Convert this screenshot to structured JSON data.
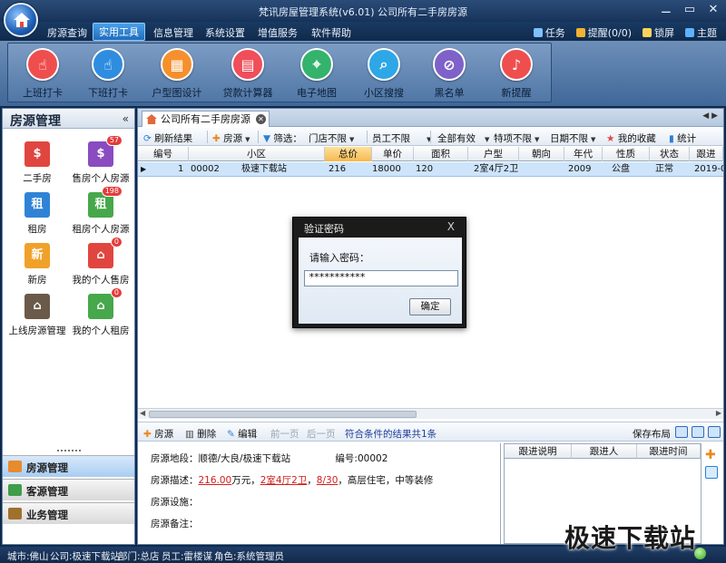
{
  "window": {
    "title": "梵讯房屋管理系统(v6.01) 公司所有二手房房源",
    "controls": [
      "⚊",
      "▭",
      "✕"
    ]
  },
  "menu": {
    "items": [
      "房源查询",
      "实用工具",
      "信息管理",
      "系统设置",
      "增值服务",
      "软件帮助"
    ],
    "active_index": 1,
    "right": {
      "task": "任务",
      "reminder": "提醒(0/0)",
      "lock": "锁屏",
      "theme": "主题"
    }
  },
  "ribbon": {
    "tools": [
      {
        "label": "上班打卡",
        "icon": "clock-in-icon",
        "color": "#ef4e4e",
        "glyph": "☝"
      },
      {
        "label": "下班打卡",
        "icon": "clock-out-icon",
        "color": "#2f8de0",
        "glyph": "☝"
      },
      {
        "label": "户型图设计",
        "icon": "floorplan-icon",
        "color": "#f5902c",
        "glyph": "▦"
      },
      {
        "label": "贷款计算器",
        "icon": "calculator-icon",
        "color": "#ef4e5a",
        "glyph": "▤"
      },
      {
        "label": "电子地图",
        "icon": "map-pin-icon",
        "color": "#33b36b",
        "glyph": "⌖"
      },
      {
        "label": "小区搜搜",
        "icon": "search-icon",
        "color": "#2ea7e6",
        "glyph": "⌕"
      },
      {
        "label": "黑名单",
        "icon": "blacklist-icon",
        "color": "#7e62c9",
        "glyph": "⊘"
      },
      {
        "label": "新提醒",
        "icon": "bell-icon",
        "color": "#ef4e4e",
        "glyph": "♪"
      }
    ]
  },
  "sidebar": {
    "title": "房源管理",
    "collapse": "«",
    "tiles": [
      {
        "label": "二手房",
        "color": "#e0463f",
        "glyph": "$",
        "badge": ""
      },
      {
        "label": "售房个人房源",
        "color": "#8a4bc0",
        "glyph": "$",
        "badge": "57"
      },
      {
        "label": "租房",
        "color": "#2f83d6",
        "glyph": "租",
        "badge": ""
      },
      {
        "label": "租房个人房源",
        "color": "#46a84b",
        "glyph": "租",
        "badge": "198"
      },
      {
        "label": "新房",
        "color": "#f0a12a",
        "glyph": "新",
        "badge": ""
      },
      {
        "label": "我的个人售房",
        "color": "#e0463f",
        "glyph": "⌂",
        "badge": "0"
      },
      {
        "label": "上线房源管理",
        "color": "#6b5a4a",
        "glyph": "⌂",
        "badge": ""
      },
      {
        "label": "我的个人租房",
        "color": "#46a84b",
        "glyph": "⌂",
        "badge": "0"
      }
    ],
    "nav": [
      {
        "label": "房源管理",
        "color": "#e88a2e"
      },
      {
        "label": "客源管理",
        "color": "#3f9e49"
      },
      {
        "label": "业务管理",
        "color": "#a0702d"
      }
    ]
  },
  "main": {
    "tab": {
      "label": "公司所有二手房房源"
    },
    "filters": {
      "refresh": "刷新结果",
      "add": "房源",
      "filter": "筛选：",
      "store": "门店不限",
      "staff": "员工不限",
      "validity": "全部有效",
      "special": "特项不限",
      "date": "日期不限",
      "favorite": "我的收藏",
      "stats": "统计"
    },
    "grid": {
      "columns": [
        "编号",
        "小区",
        "总价",
        "单价",
        "面积",
        "户型",
        "朝向",
        "年代",
        "性质",
        "状态",
        "跟进"
      ],
      "rows": [
        {
          "n": "1",
          "id": "00002",
          "community": "极速下载站",
          "total": "216",
          "unit": "18000",
          "area": "120",
          "layout": "2室4厅2卫",
          "orient": "",
          "year": "2009",
          "nature": "公盘",
          "status": "正常",
          "follow": "2019-0"
        }
      ]
    },
    "actions": {
      "add": "房源",
      "delete": "删除",
      "edit": "编辑",
      "prev": "前一页",
      "next": "后一页",
      "result": "符合条件的结果共1条",
      "save_layout": "保存布局"
    },
    "detail": {
      "location_label": "房源地段：",
      "location": "顺德/大良/极速下载站",
      "id_label": "编号:",
      "id": "00002",
      "desc_label": "房源描述：",
      "price": "216.00",
      "price_unit": "万元，",
      "layout": "2室4厅2卫",
      "floor": "8/30",
      "desc_rest": "高层住宅，中等装修",
      "facility_label": "房源设施：",
      "remark_label": "房源备注："
    },
    "follow": {
      "columns": [
        "跟进说明",
        "跟进人",
        "跟进时间"
      ]
    }
  },
  "dialog": {
    "title": "验证密码",
    "close": "X",
    "label": "请输入密码：",
    "password": "***********",
    "ok": "确定"
  },
  "status": {
    "city": "城市:佛山",
    "company": "公司:极速下载站",
    "dept": "部门:总店",
    "staff": "员工:雷楼谋",
    "role": "角色:系统管理员"
  },
  "watermark": "极速下载站"
}
